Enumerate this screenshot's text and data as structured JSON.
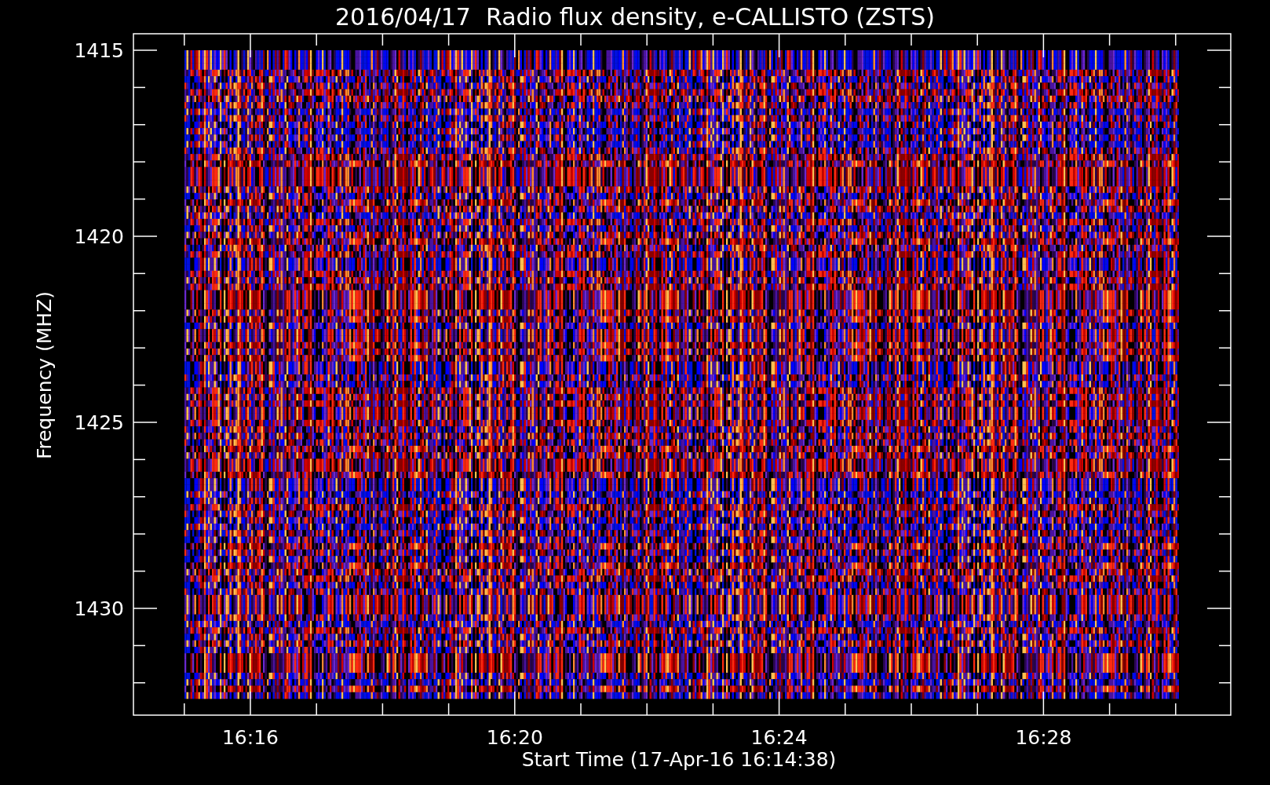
{
  "title": "2016/04/17  Radio flux density, e-CALLISTO (ZSTS)",
  "y_axis": {
    "label": "Frequency (MHZ)",
    "ticks": [
      "1415",
      "1420",
      "1425",
      "1430"
    ]
  },
  "x_axis": {
    "label": "Start Time (17-Apr-16 16:14:38)",
    "ticks": [
      "16:16",
      "16:20",
      "16:24",
      "16:28"
    ]
  }
}
